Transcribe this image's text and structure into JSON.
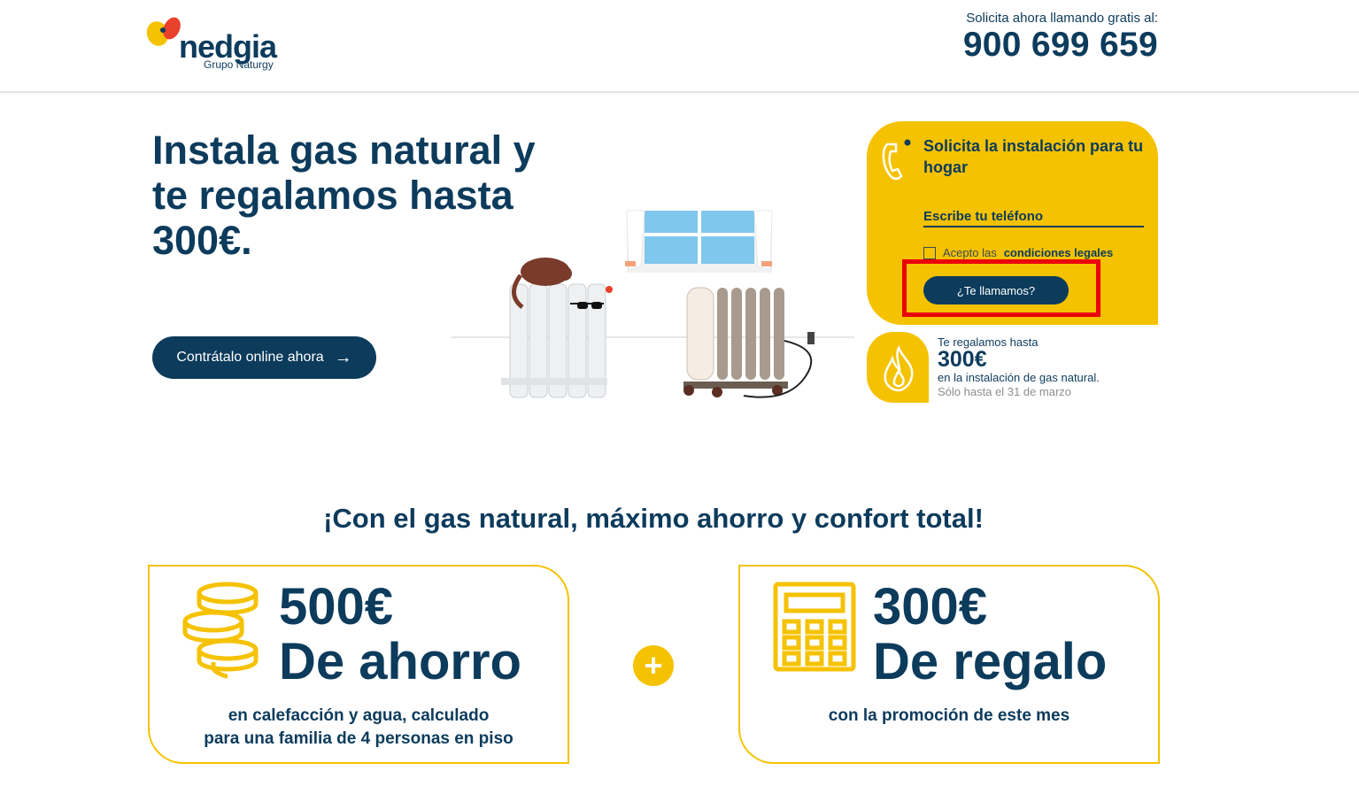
{
  "header": {
    "logo_text": "nedgia",
    "logo_subtext": "Grupo Naturgy",
    "call_label": "Solicita ahora llamando gratis al:",
    "phone_number": "900 699 659"
  },
  "hero": {
    "title": "Instala gas natural y te regalamos hasta 300€.",
    "cta_label": "Contrátalo online ahora",
    "cta_arrow": "→"
  },
  "form": {
    "title": "Solicita la instalación para tu hogar",
    "phone_placeholder": "Escribe tu teléfono",
    "legal_prefix": "Acepto las",
    "legal_link": "condiciones legales",
    "submit_label": "¿Te llamamos?"
  },
  "promo": {
    "line1": "Te regalamos hasta",
    "amount": "300€",
    "line3": "en la instalación de gas natural.",
    "line4": "Sólo hasta el 31 de marzo"
  },
  "benefits": {
    "section_title": "¡Con el gas natural, máximo ahorro y confort total!",
    "plus_symbol": "+",
    "items": [
      {
        "amount": "500€",
        "label": "De ahorro",
        "desc_line1": "en calefacción y agua, calculado",
        "desc_line2": "para una familia de 4 personas en piso",
        "icon": "coins-icon"
      },
      {
        "amount": "300€",
        "label": "De regalo",
        "desc_line1": "con la promoción de este mes",
        "icon": "calculator-icon"
      }
    ]
  },
  "colors": {
    "brand_navy": "#0c3b5c",
    "brand_yellow": "#f5c200",
    "highlight_red": "#ea0009"
  }
}
